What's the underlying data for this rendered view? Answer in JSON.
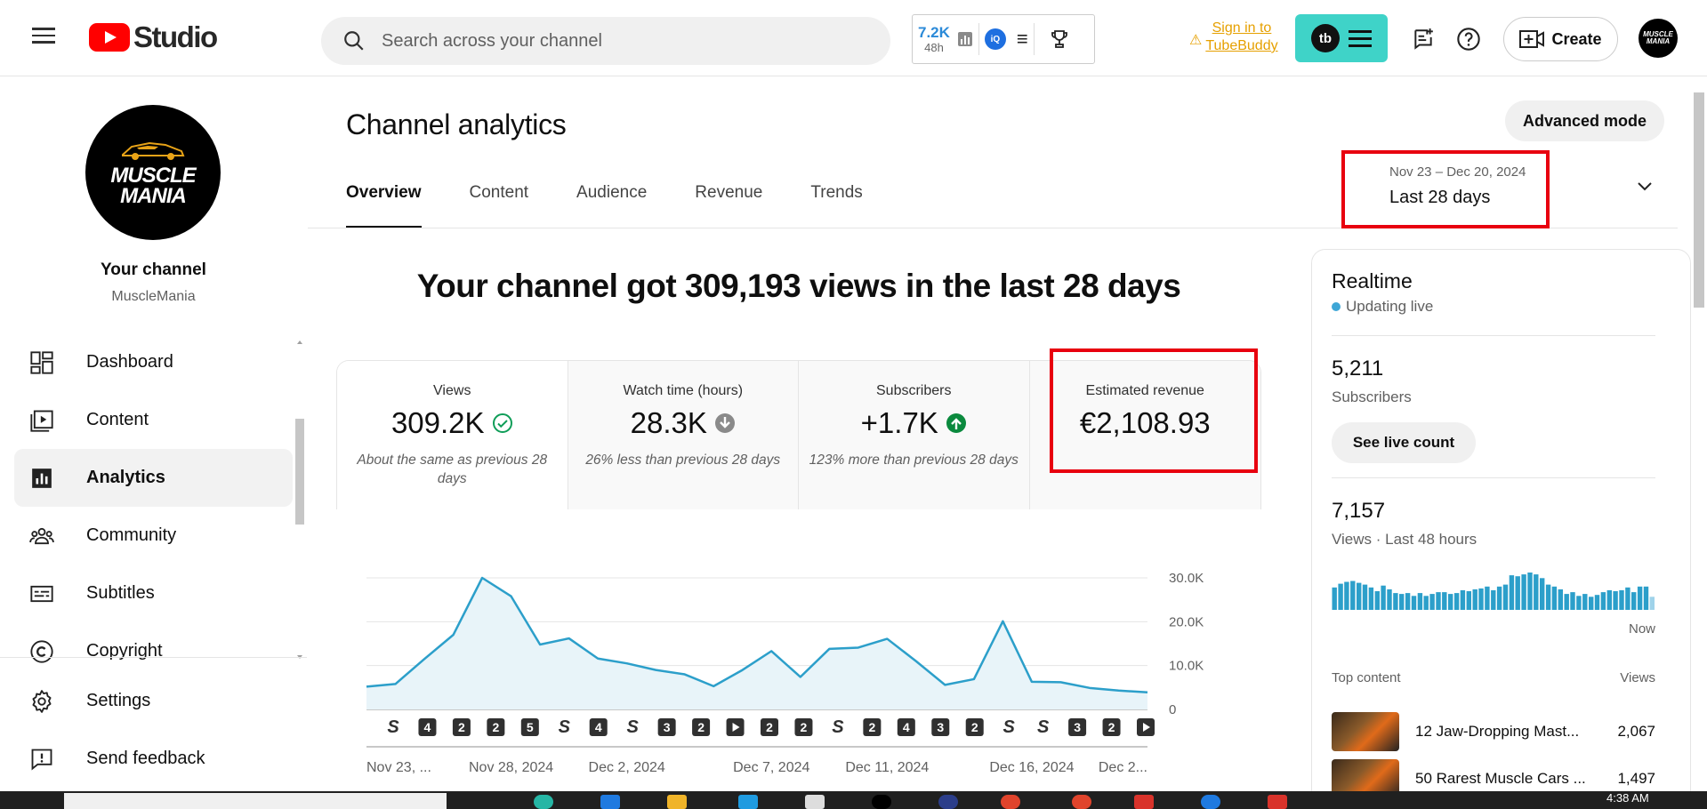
{
  "app": {
    "logo_text": "Studio",
    "search_placeholder": "Search across your channel"
  },
  "vidiq": {
    "views": "7.2K",
    "period": "48h",
    "iq_label": "iQ"
  },
  "tubebuddy": {
    "signin_line1": "Sign in to",
    "signin_line2": "TubeBuddy",
    "logo_label": "tb"
  },
  "header": {
    "create_label": "Create",
    "avatar_text": "MUSCLE MANIA"
  },
  "channel": {
    "avatar_line1": "MUSCLE",
    "avatar_line2": "MANIA",
    "your_channel": "Your channel",
    "handle": "MuscleMania"
  },
  "sidebar": {
    "items": [
      {
        "label": "Dashboard",
        "icon": "dashboard-icon"
      },
      {
        "label": "Content",
        "icon": "content-icon"
      },
      {
        "label": "Analytics",
        "icon": "analytics-icon",
        "active": true
      },
      {
        "label": "Community",
        "icon": "community-icon"
      },
      {
        "label": "Subtitles",
        "icon": "subtitles-icon"
      },
      {
        "label": "Copyright",
        "icon": "copyright-icon"
      }
    ],
    "bottom": [
      {
        "label": "Settings",
        "icon": "gear-icon"
      },
      {
        "label": "Send feedback",
        "icon": "feedback-icon"
      }
    ]
  },
  "page": {
    "title": "Channel analytics",
    "advanced_mode": "Advanced mode",
    "tabs": [
      "Overview",
      "Content",
      "Audience",
      "Revenue",
      "Trends"
    ],
    "active_tab": "Overview",
    "date_range": "Nov 23 – Dec 20, 2024",
    "date_period": "Last 28 days",
    "headline": "Your channel got 309,193 views in the last 28 days"
  },
  "metrics": [
    {
      "name": "Views",
      "value": "309.2K",
      "status": "check",
      "comparison": "About the same as previous 28 days"
    },
    {
      "name": "Watch time (hours)",
      "value": "28.3K",
      "status": "down",
      "comparison": "26% less than previous 28 days"
    },
    {
      "name": "Subscribers",
      "value": "+1.7K",
      "status": "up",
      "comparison": "123% more than previous 28 days"
    },
    {
      "name": "Estimated revenue",
      "value": "€2,108.93",
      "status": "",
      "comparison": ""
    }
  ],
  "chart_data": {
    "type": "area",
    "series": [
      {
        "values": [
          5200,
          5800,
          11500,
          17000,
          30000,
          25800,
          14800,
          16200,
          11600,
          10500,
          9000,
          8000,
          5300,
          9000,
          13300,
          7400,
          13800,
          14100,
          16100,
          11000,
          5600,
          6900,
          20100,
          6300,
          6200,
          4900,
          4300,
          3900
        ]
      }
    ],
    "ylim": [
      0,
      30000
    ],
    "y_ticks": [
      "30.0K",
      "20.0K",
      "10.0K",
      "0"
    ],
    "x_ticks": [
      "Nov 23, ...",
      "Nov 28, 2024",
      "Dec 2, 2024",
      "Dec 7, 2024",
      "Dec 11, 2024",
      "Dec 16, 2024",
      "Dec 2..."
    ],
    "upload_markers": [
      "S",
      "4",
      "2",
      "2",
      "5",
      "S",
      "4",
      "S",
      "3",
      "2",
      "V",
      "2",
      "2",
      "S",
      "2",
      "4",
      "3",
      "2",
      "S",
      "S",
      "3",
      "2",
      "V"
    ],
    "accent": "#2c9fca",
    "fill": "#e8f4f9"
  },
  "realtime": {
    "title": "Realtime",
    "status": "Updating live",
    "subscribers": "5,211",
    "subscribers_label": "Subscribers",
    "live_count_button": "See live count",
    "views": "7,157",
    "views_label": "Views · Last 48 hours",
    "now_label": "Now",
    "hourly_views": [
      24,
      28,
      30,
      31,
      29,
      27,
      24,
      20,
      26,
      22,
      18,
      17,
      18,
      15,
      18,
      15,
      17,
      19,
      19,
      17,
      18,
      21,
      20,
      22,
      23,
      25,
      21,
      25,
      27,
      37,
      36,
      38,
      40,
      38,
      34,
      27,
      25,
      22,
      17,
      19,
      15,
      17,
      14,
      16,
      19,
      21,
      20,
      21,
      24,
      19,
      25,
      25,
      14
    ],
    "top_content_label": "Top content",
    "views_column": "Views",
    "top_content": [
      {
        "title": "12 Jaw-Dropping Mast...",
        "views": "2,067"
      },
      {
        "title": "50 Rarest Muscle Cars ...",
        "views": "1,497"
      }
    ]
  },
  "taskbar": {
    "time": "4:38 AM"
  }
}
